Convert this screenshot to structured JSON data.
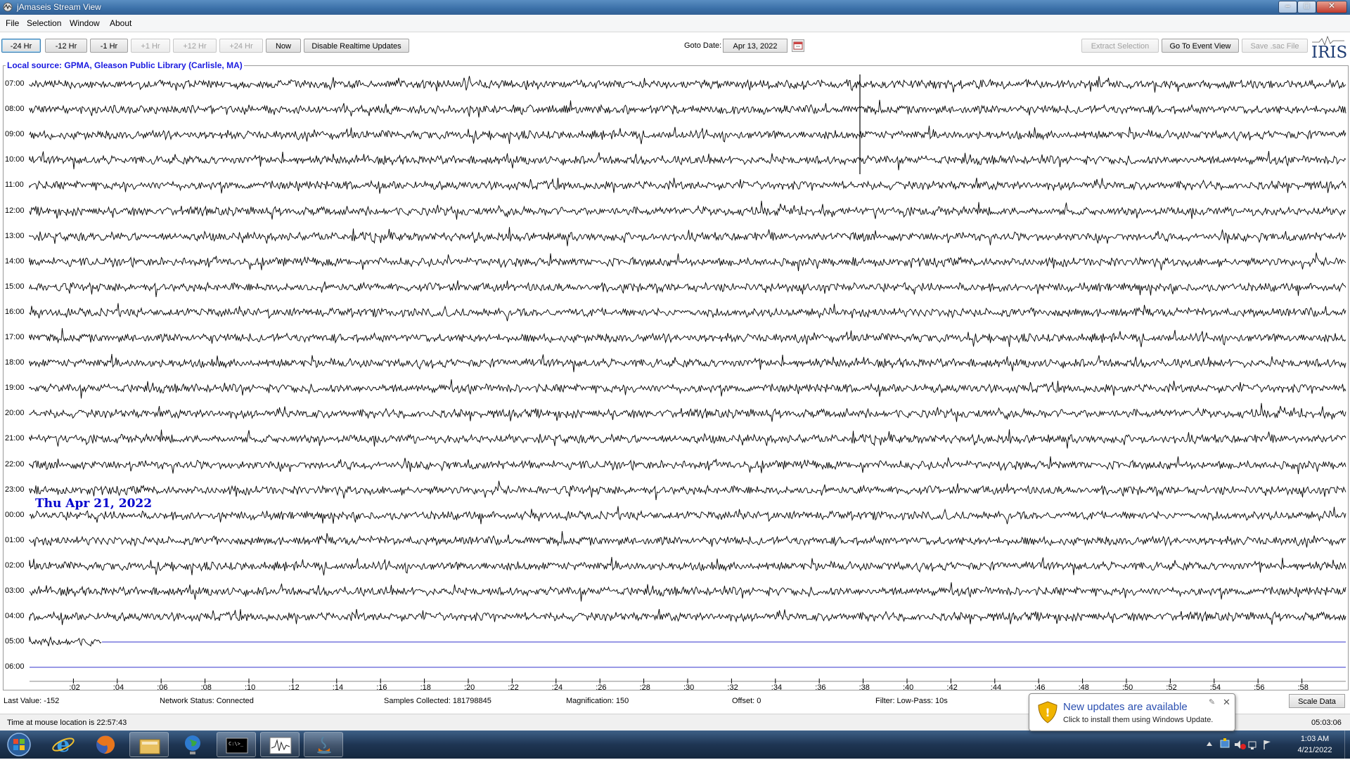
{
  "window": {
    "title": "jAmaseis Stream View"
  },
  "menu": [
    "File",
    "Selection",
    "Window",
    "About"
  ],
  "toolbar": {
    "buttons": [
      {
        "label": "-24 Hr",
        "enabled": true,
        "selected": true
      },
      {
        "label": "-12 Hr",
        "enabled": true
      },
      {
        "label": "-1 Hr",
        "enabled": true
      },
      {
        "label": "+1 Hr",
        "enabled": false
      },
      {
        "label": "+12 Hr",
        "enabled": false
      },
      {
        "label": "+24 Hr",
        "enabled": false
      },
      {
        "label": "Now",
        "enabled": true
      },
      {
        "label": "Disable Realtime Updates",
        "enabled": true
      }
    ],
    "goto_label": "Goto Date:",
    "goto_value": "Apr 13, 2022",
    "extract_label": "Extract Selection",
    "event_view_label": "Go To Event View",
    "save_sac_label": "Save .sac File",
    "logo_text": "IRIS"
  },
  "plot": {
    "title": "Local source: GPMA, Gleason Public Library (Carlisle, MA)",
    "hours": [
      "07:00",
      "08:00",
      "09:00",
      "10:00",
      "11:00",
      "12:00",
      "13:00",
      "14:00",
      "15:00",
      "16:00",
      "17:00",
      "18:00",
      "19:00",
      "20:00",
      "21:00",
      "22:00",
      "23:00",
      "00:00",
      "01:00",
      "02:00",
      "03:00",
      "04:00",
      "05:00",
      "06:00"
    ],
    "date_marker": "Thu Apr 21, 2022",
    "minutes": [
      ":02",
      ":04",
      ":06",
      ":08",
      ":10",
      ":12",
      ":14",
      ":16",
      ":18",
      ":20",
      ":22",
      ":24",
      ":26",
      ":28",
      ":30",
      ":32",
      ":34",
      ":36",
      ":38",
      ":40",
      ":42",
      ":44",
      ":46",
      ":48",
      ":50",
      ":52",
      ":54",
      ":56",
      ":58"
    ],
    "live_row_fraction": 0.055,
    "colors": {
      "trace": "#000000",
      "baseline": "#3333cc",
      "title": "#1a1ae0",
      "date": "#0000cc"
    }
  },
  "status": {
    "last_value": "Last Value:  -152",
    "network": "Network Status:  Connected",
    "samples": "Samples Collected:  181798845",
    "magnification": "Magnification:  150",
    "offset": "Offset:  0",
    "filter": "Filter:  Low-Pass: 10s",
    "scale_button": "Scale Data",
    "mouse_time": "Time at mouse location is 22:57:43",
    "elapsed": "05:03:06"
  },
  "notification": {
    "title": "New updates are available",
    "body": "Click to install them using Windows Update."
  },
  "taskbar": {
    "time": "1:03 AM",
    "date": "4/21/2022",
    "items": [
      "start-orb",
      "internet-explorer-icon",
      "firefox-icon",
      "file-explorer-icon",
      "globe-app-icon",
      "command-prompt-icon",
      "seismograph-app-icon",
      "java-app-icon"
    ]
  }
}
